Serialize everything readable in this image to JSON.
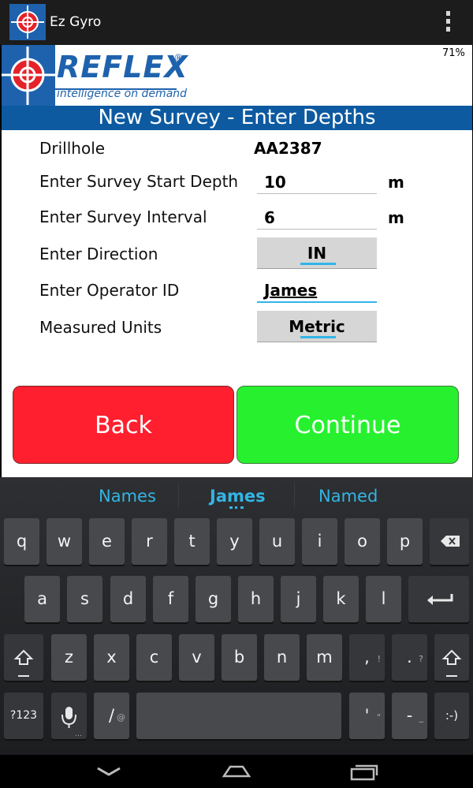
{
  "app": {
    "title": "Ez Gyro",
    "battery": "71%"
  },
  "logo": {
    "brand": "REFLEX",
    "trademark": "®",
    "tagline": "intelligence on demand"
  },
  "screen_title": "New Survey - Enter Depths",
  "form": {
    "drillhole": {
      "label": "Drillhole",
      "value": "AA2387"
    },
    "start_depth": {
      "label": "Enter Survey Start Depth",
      "value": "10",
      "unit": "m"
    },
    "interval": {
      "label": "Enter Survey Interval",
      "value": "6",
      "unit": "m"
    },
    "direction": {
      "label": "Enter Direction",
      "value": "IN"
    },
    "operator": {
      "label": "Enter Operator ID",
      "value": "James"
    },
    "units": {
      "label": "Measured Units",
      "value": "Metric"
    }
  },
  "buttons": {
    "back": "Back",
    "continue": "Continue"
  },
  "keyboard": {
    "suggestions": [
      "Names",
      "James",
      "Named"
    ],
    "row1": [
      "q",
      "w",
      "e",
      "r",
      "t",
      "y",
      "u",
      "i",
      "o",
      "p"
    ],
    "row2": [
      "a",
      "s",
      "d",
      "f",
      "g",
      "h",
      "j",
      "k",
      "l"
    ],
    "row3": [
      "z",
      "x",
      "c",
      "v",
      "b",
      "n",
      "m",
      ",",
      "."
    ],
    "row3_hints": [
      "!",
      "?"
    ],
    "row4": {
      "symbols": "?123",
      "slash": "/",
      "slash_hint": "@",
      "apostrophe": "'",
      "apostrophe_hint": "\"",
      "dash": "-",
      "dash_hint": "_",
      "smiley": ":-)"
    }
  },
  "colors": {
    "back": "#ff1f2e",
    "continue": "#27f12f",
    "title_bar": "#0d5aa1",
    "brand": "#1e62ad",
    "accent": "#33b5e5"
  },
  "icons": [
    "app-icon",
    "overflow-menu-icon",
    "backspace-icon",
    "enter-icon",
    "shift-icon",
    "microphone-icon",
    "nav-back-icon",
    "nav-home-icon",
    "nav-recents-icon"
  ]
}
